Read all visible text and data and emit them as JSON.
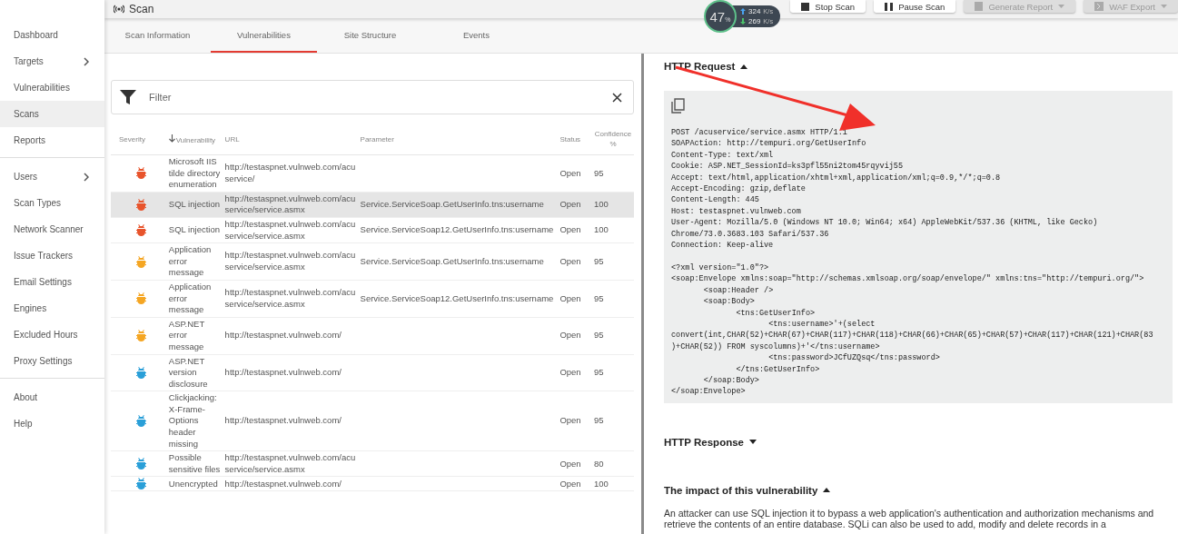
{
  "header": {
    "title": "Scan",
    "buttons": [
      {
        "label": "Stop Scan",
        "kind": "stop",
        "disabled": false
      },
      {
        "label": "Pause Scan",
        "kind": "pause",
        "disabled": false
      },
      {
        "label": "Generate Report",
        "kind": "report",
        "disabled": true
      },
      {
        "label": "WAF Export",
        "kind": "export",
        "disabled": true
      }
    ]
  },
  "speed_widget": {
    "percent": "47",
    "percent_unit": "%",
    "upload_value": "324",
    "upload_unit": "K/s",
    "download_value": "269",
    "download_unit": "K/s"
  },
  "sidebar": {
    "groups": [
      [
        {
          "label": "Dashboard",
          "selected": false,
          "has_submenu": false
        },
        {
          "label": "Targets",
          "selected": false,
          "has_submenu": true
        },
        {
          "label": "Vulnerabilities",
          "selected": false,
          "has_submenu": false
        },
        {
          "label": "Scans",
          "selected": true,
          "has_submenu": false
        },
        {
          "label": "Reports",
          "selected": false,
          "has_submenu": false
        }
      ],
      [
        {
          "label": "Users",
          "selected": false,
          "has_submenu": true
        },
        {
          "label": "Scan Types",
          "selected": false,
          "has_submenu": false
        },
        {
          "label": "Network Scanner",
          "selected": false,
          "has_submenu": false
        },
        {
          "label": "Issue Trackers",
          "selected": false,
          "has_submenu": false
        },
        {
          "label": "Email Settings",
          "selected": false,
          "has_submenu": false
        },
        {
          "label": "Engines",
          "selected": false,
          "has_submenu": false
        },
        {
          "label": "Excluded Hours",
          "selected": false,
          "has_submenu": false
        },
        {
          "label": "Proxy Settings",
          "selected": false,
          "has_submenu": false
        }
      ],
      [
        {
          "label": "About",
          "selected": false,
          "has_submenu": false
        },
        {
          "label": "Help",
          "selected": false,
          "has_submenu": false
        }
      ]
    ]
  },
  "tabs": [
    {
      "label": "Scan Information",
      "selected": false
    },
    {
      "label": "Vulnerabilities",
      "selected": true
    },
    {
      "label": "Site Structure",
      "selected": false
    },
    {
      "label": "Events",
      "selected": false
    }
  ],
  "filter": {
    "placeholder": "Filter"
  },
  "table": {
    "columns": [
      "Severity",
      "Vulnerability",
      "URL",
      "Parameter",
      "Status",
      "Confidence %"
    ],
    "rows": [
      {
        "color": "#e8542c",
        "vulnerability": "Microsoft IIS tilde directory enumeration",
        "url": "http://testaspnet.vulnweb.com/acuservice/",
        "parameter": "",
        "status": "Open",
        "confidence": "95",
        "selected": false
      },
      {
        "color": "#e8542c",
        "vulnerability": "SQL injection",
        "url": "http://testaspnet.vulnweb.com/acuservice/service.asmx",
        "parameter": "Service.ServiceSoap.GetUserInfo.tns:username",
        "status": "Open",
        "confidence": "100",
        "selected": true
      },
      {
        "color": "#e8542c",
        "vulnerability": "SQL injection",
        "url": "http://testaspnet.vulnweb.com/acuservice/service.asmx",
        "parameter": "Service.ServiceSoap12.GetUserInfo.tns:username",
        "status": "Open",
        "confidence": "100",
        "selected": false
      },
      {
        "color": "#f5a623",
        "vulnerability": "Application error message",
        "url": "http://testaspnet.vulnweb.com/acuservice/service.asmx",
        "parameter": "Service.ServiceSoap.GetUserInfo.tns:username",
        "status": "Open",
        "confidence": "95",
        "selected": false
      },
      {
        "color": "#f5a623",
        "vulnerability": "Application error message",
        "url": "http://testaspnet.vulnweb.com/acuservice/service.asmx",
        "parameter": "Service.ServiceSoap12.GetUserInfo.tns:username",
        "status": "Open",
        "confidence": "95",
        "selected": false
      },
      {
        "color": "#f5a623",
        "vulnerability": "ASP.NET error message",
        "url": "http://testaspnet.vulnweb.com/",
        "parameter": "",
        "status": "Open",
        "confidence": "95",
        "selected": false
      },
      {
        "color": "#2a9fd8",
        "vulnerability": "ASP.NET version disclosure",
        "url": "http://testaspnet.vulnweb.com/",
        "parameter": "",
        "status": "Open",
        "confidence": "95",
        "selected": false
      },
      {
        "color": "#2a9fd8",
        "vulnerability": "Clickjacking: X-Frame-Options header missing",
        "url": "http://testaspnet.vulnweb.com/",
        "parameter": "",
        "status": "Open",
        "confidence": "95",
        "selected": false
      },
      {
        "color": "#2a9fd8",
        "vulnerability": "Possible sensitive files",
        "url": "http://testaspnet.vulnweb.com/acuservice/service.asmx",
        "parameter": "",
        "status": "Open",
        "confidence": "80",
        "selected": false
      },
      {
        "color": "#2a9fd8",
        "vulnerability": "Unencrypted",
        "url": "http://testaspnet.vulnweb.com/",
        "parameter": "",
        "status": "Open",
        "confidence": "100",
        "selected": false
      }
    ]
  },
  "details": {
    "sections": [
      {
        "title": "HTTP Request",
        "expanded": true,
        "kind": "code",
        "content": "POST /acuservice/service.asmx HTTP/1.1\nSOAPAction: http://tempuri.org/GetUserInfo\nContent-Type: text/xml\nCookie: ASP.NET_SessionId=ks3pfl55ni2tom45rqyvij55\nAccept: text/html,application/xhtml+xml,application/xml;q=0.9,*/*;q=0.8\nAccept-Encoding: gzip,deflate\nContent-Length: 445\nHost: testaspnet.vulnweb.com\nUser-Agent: Mozilla/5.0 (Windows NT 10.0; Win64; x64) AppleWebKit/537.36 (KHTML, like Gecko)\nChrome/73.0.3683.103 Safari/537.36\nConnection: Keep-alive\n\n<?xml version=\"1.0\"?>\n<soap:Envelope xmlns:soap=\"http://schemas.xmlsoap.org/soap/envelope/\" xmlns:tns=\"http://tempuri.org/\">\n\t<soap:Header />\n\t<soap:Body>\n\t\t<tns:GetUserInfo>\n\t\t\t<tns:username>'+(select\nconvert(int,CHAR(52)+CHAR(67)+CHAR(117)+CHAR(118)+CHAR(66)+CHAR(65)+CHAR(57)+CHAR(117)+CHAR(121)+CHAR(83\n)+CHAR(52)) FROM syscolumns)+'</tns:username>\n\t\t\t<tns:password>JCfUZQsq</tns:password>\n\t\t</tns:GetUserInfo>\n\t</soap:Body>\n</soap:Envelope>"
      },
      {
        "title": "HTTP Response",
        "expanded": false
      },
      {
        "title": "The impact of this vulnerability",
        "expanded": true,
        "kind": "text",
        "content": "An attacker can use SQL injection it to bypass a web application's authentication and authorization mechanisms and retrieve the contents of an entire database. SQLi can also be used to add, modify and delete records in a"
      }
    ]
  }
}
